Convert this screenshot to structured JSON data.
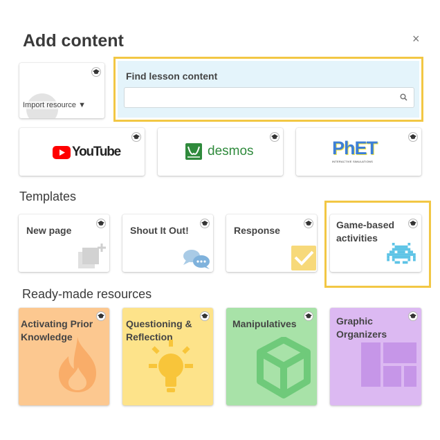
{
  "dialog": {
    "title": "Add content",
    "close_label": "×"
  },
  "import_resource": {
    "label": "Import resource ▼"
  },
  "find_lesson": {
    "label": "Find lesson content",
    "placeholder": ""
  },
  "providers": [
    {
      "name": "YouTube"
    },
    {
      "name": "desmos"
    },
    {
      "name": "PhET",
      "tagline": "INTERACTIVE SIMULATIONS"
    }
  ],
  "templates": {
    "heading": "Templates",
    "items": [
      {
        "label": "New page",
        "icon": "new-page-icon"
      },
      {
        "label": "Shout It Out!",
        "icon": "speech-bubbles-icon"
      },
      {
        "label": "Response",
        "icon": "checkbox-icon"
      },
      {
        "label": "Game-based activities",
        "icon": "space-invader-icon"
      }
    ]
  },
  "ready_made": {
    "heading": "Ready-made resources",
    "items": [
      {
        "label": "Activating Prior Knowledge",
        "color": "#fcc890",
        "icon": "flame-icon"
      },
      {
        "label": "Questioning & Reflection",
        "color": "#fde38a",
        "icon": "lightbulb-icon"
      },
      {
        "label": "Manipulatives",
        "color": "#a8e2a8",
        "icon": "cube-icon"
      },
      {
        "label": "Graphic Organizers",
        "color": "#dcb9f2",
        "icon": "layout-icon"
      }
    ]
  },
  "colors": {
    "highlight": "#f2c744",
    "find_background": "#e4f4fb",
    "youtube_red": "#ff0000",
    "desmos_green": "#2f8a3c",
    "phet_yellow": "#f5e63c",
    "phet_blue": "#3d7fd6"
  }
}
